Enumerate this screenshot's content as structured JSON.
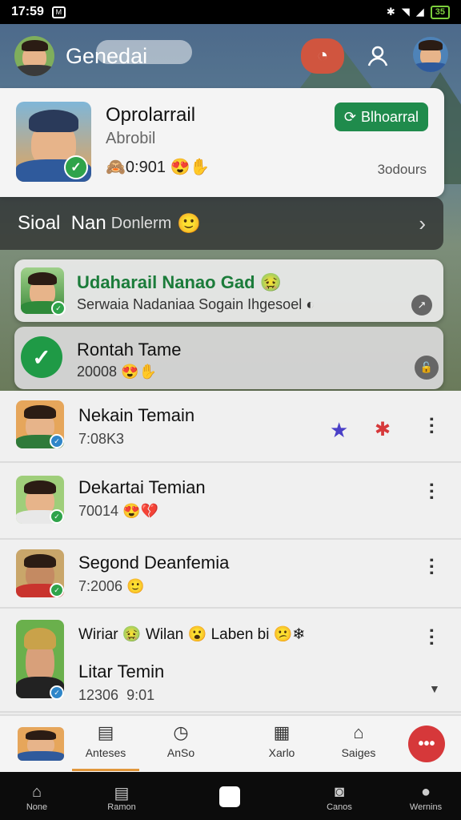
{
  "status_bar": {
    "time": "17:59",
    "battery": "35"
  },
  "header": {
    "title": "Genedai"
  },
  "profile_card": {
    "name": "Oprolarrail",
    "subtitle": "Abrobil",
    "stats": "0:901",
    "time": "3odours",
    "button_label": "Blhoarral"
  },
  "section": {
    "title": "Sioal",
    "title2": "Nan",
    "muted": "Donlerm"
  },
  "group_cards": [
    {
      "title": "Udaharail Nanao Gad",
      "subtitle": "Serwaia Nadaniaa Sogain Ihgesoel"
    },
    {
      "title": "Rontah Tame",
      "subtitle": "20008"
    }
  ],
  "friends": [
    {
      "name": "Nekain Temain",
      "meta": "7:08K3"
    },
    {
      "name": "Dekartai Temian",
      "meta": "70014"
    },
    {
      "name": "Segond Deanfemia",
      "meta": "7:2006"
    },
    {
      "name": "Litar Temin",
      "meta": "12306",
      "extra": "9:01",
      "chips": "Wiriar",
      "chip2": "Wilan",
      "chip3": "Laben bi"
    }
  ],
  "tabs": [
    "Anteses",
    "AnSo",
    "Xarlo",
    "Saiges"
  ],
  "nav": [
    "None",
    "Ramon",
    "Canos",
    "Wernins"
  ],
  "colors": {
    "accent_green": "#1f8b4c",
    "accent_red": "#d6383a",
    "underline": "#e1973b"
  }
}
